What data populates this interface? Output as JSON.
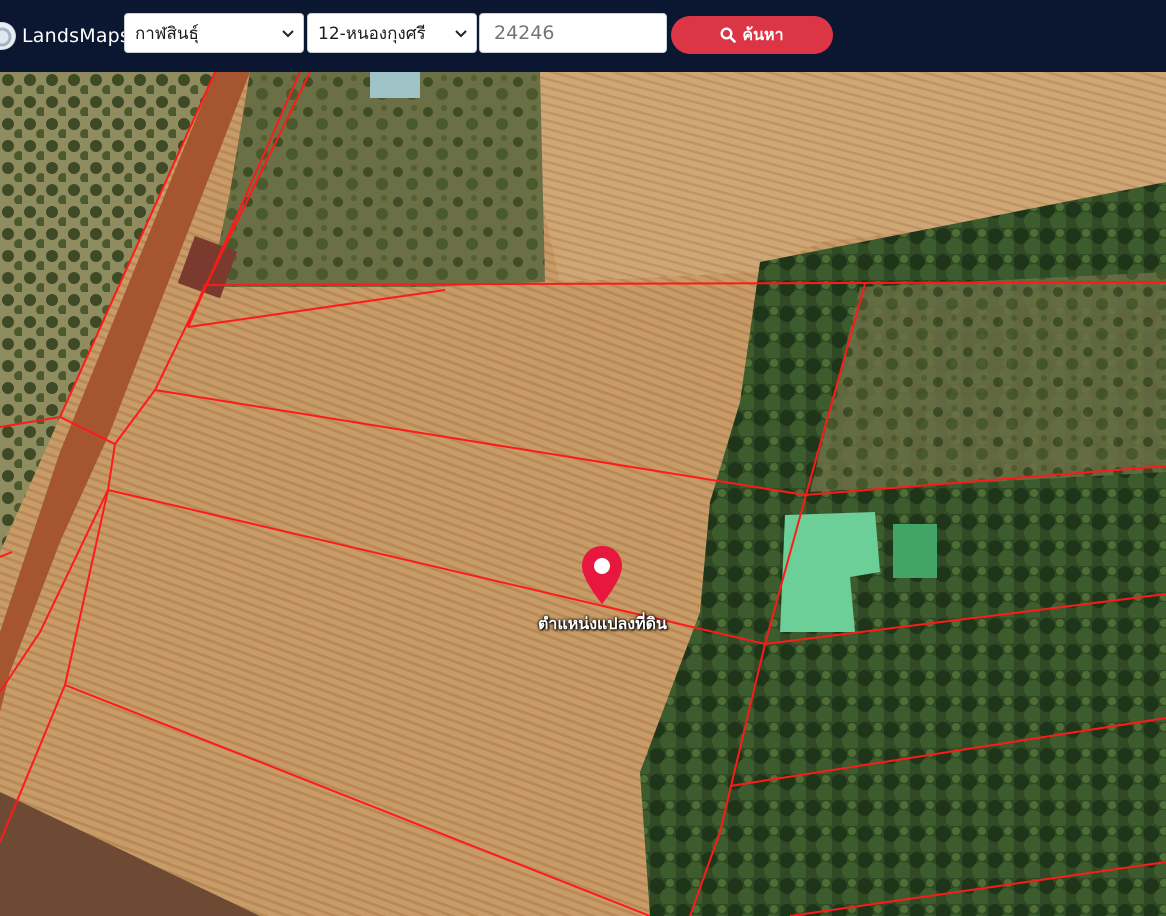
{
  "header": {
    "brand": "LandsMaps",
    "province_select": {
      "value": "กาฬสินธุ์"
    },
    "district_select": {
      "value": "12-หนองกุงศรี"
    },
    "parcel_input": {
      "value": "",
      "placeholder": "24246"
    },
    "search_button": {
      "label": "ค้นหา",
      "icon": "search-icon"
    },
    "accent_color": "#dc3545",
    "background_color": "#0b1730"
  },
  "map": {
    "type": "satellite",
    "boundary_color": "#ff0000",
    "marker": {
      "icon": "map-pin-icon",
      "color": "#e8173d",
      "label": "ตำแหน่งแปลงที่ดิน"
    }
  }
}
